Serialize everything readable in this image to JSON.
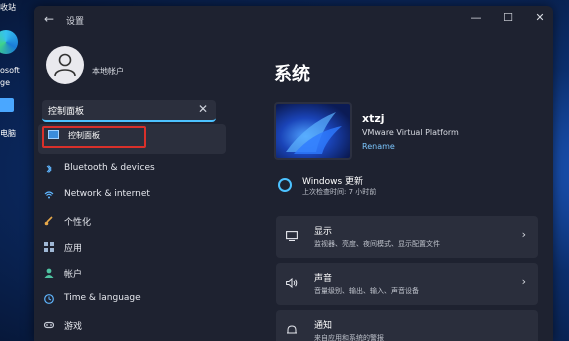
{
  "desktop": {
    "top_label": "收站",
    "edge_label_1": "osoft",
    "edge_label_2": "ge",
    "pc_label": "电脑"
  },
  "window": {
    "title": "设置",
    "controls": [
      "—",
      "☐",
      "✕"
    ]
  },
  "account": {
    "name": "本地帐户"
  },
  "search": {
    "value": "控制面板",
    "clear": "✕"
  },
  "suggestion": {
    "label": "控制面板"
  },
  "nav": {
    "items": [
      {
        "label": "Bluetooth & devices",
        "icon": "bluetooth-icon"
      },
      {
        "label": "Network & internet",
        "icon": "wifi-icon"
      },
      {
        "label": "个性化",
        "icon": "brush-icon"
      },
      {
        "label": "应用",
        "icon": "apps-icon"
      },
      {
        "label": "帐户",
        "icon": "person-icon"
      },
      {
        "label": "Time & language",
        "icon": "globe-clock-icon"
      },
      {
        "label": "游戏",
        "icon": "gamepad-icon"
      }
    ]
  },
  "main": {
    "title": "系统",
    "pc_name": "xtzj",
    "pc_model": "VMware Virtual Platform",
    "rename": "Rename",
    "update_title": "Windows 更新",
    "update_sub": "上次检查时间: 7 小时前",
    "cards": [
      {
        "title": "显示",
        "sub": "监视器、亮度、夜间模式、显示配置文件",
        "icon": "monitor-icon"
      },
      {
        "title": "声音",
        "sub": "音量级别、输出、输入、声音设备",
        "icon": "speaker-icon"
      },
      {
        "title": "通知",
        "sub": "来自应用和系统的警报",
        "icon": "bell-icon"
      }
    ]
  },
  "colors": {
    "accent": "#4cc2ff",
    "highlight": "#d9302a"
  }
}
